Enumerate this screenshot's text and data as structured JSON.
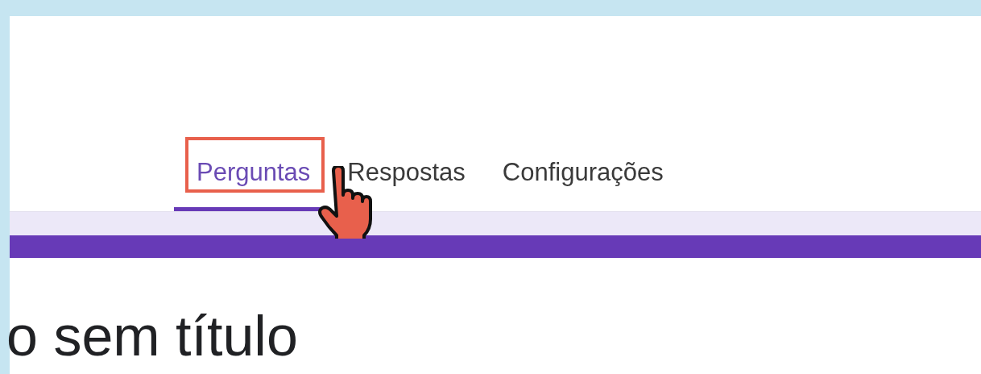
{
  "tabs": [
    {
      "label": "Perguntas",
      "selected": true,
      "highlighted": true
    },
    {
      "label": "Respostas",
      "selected": false,
      "highlighted": false
    },
    {
      "label": "Configurações",
      "selected": false,
      "highlighted": false
    }
  ],
  "form_title": "o sem título"
}
